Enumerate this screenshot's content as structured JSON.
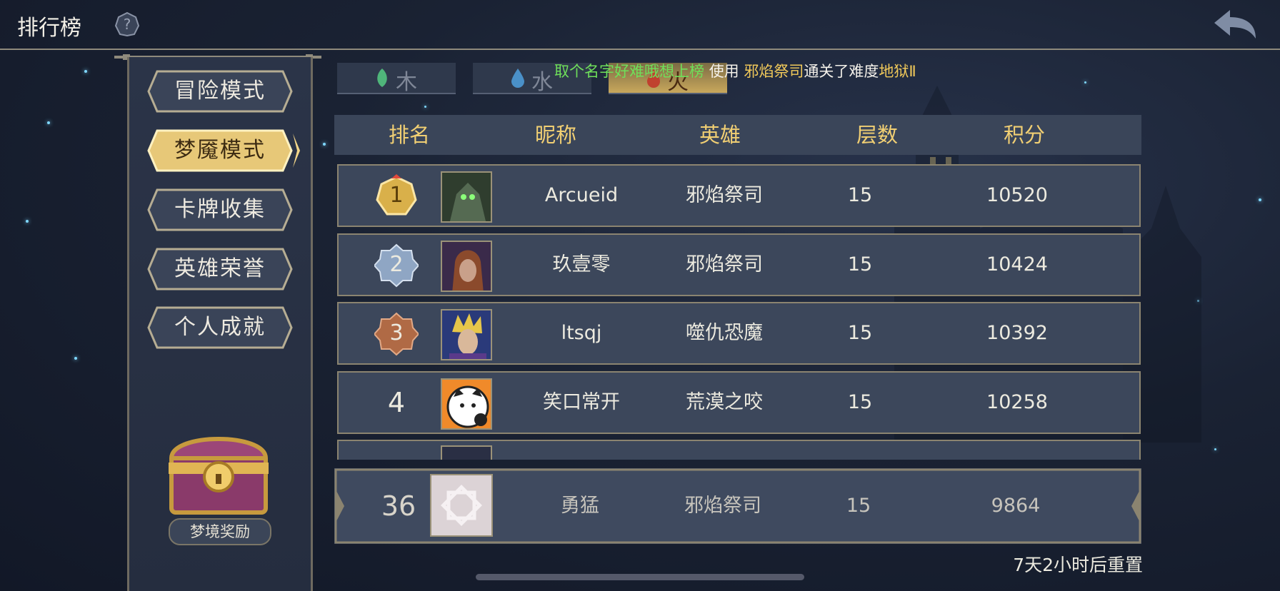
{
  "header": {
    "title": "排行榜",
    "help_icon": "question-icon",
    "back_icon": "back-arrow-icon"
  },
  "sidebar": {
    "items": [
      {
        "label": "冒险模式",
        "active": false
      },
      {
        "label": "梦魇模式",
        "active": true
      },
      {
        "label": "卡牌收集",
        "active": false
      },
      {
        "label": "英雄荣誉",
        "active": false
      },
      {
        "label": "个人成就",
        "active": false
      }
    ],
    "reward_label": "梦境奖励"
  },
  "tabs": [
    {
      "label": "木",
      "icon": "leaf-icon",
      "color": "#4fb57a"
    },
    {
      "label": "水",
      "icon": "water-drop-icon",
      "color": "#4a90c8"
    },
    {
      "label": "火",
      "icon": "fire-icon",
      "color": "#c0412f"
    }
  ],
  "banner": {
    "player": "取个名字好难哦想上榜",
    "use_text": "使用",
    "hero": "邪焰祭司",
    "cleared_text": "通关了难度",
    "difficulty": "地狱Ⅱ"
  },
  "table": {
    "columns": [
      "排名",
      "昵称",
      "英雄",
      "层数",
      "积分"
    ],
    "rows": [
      {
        "rank": "1",
        "name": "Arcueid",
        "hero": "邪焰祭司",
        "floors": "15",
        "score": "10520"
      },
      {
        "rank": "2",
        "name": "玖壹零",
        "hero": "邪焰祭司",
        "floors": "15",
        "score": "10424"
      },
      {
        "rank": "3",
        "name": "ltsqj",
        "hero": "噬仇恐魔",
        "floors": "15",
        "score": "10392"
      },
      {
        "rank": "4",
        "name": "笑口常开",
        "hero": "荒漠之咬",
        "floors": "15",
        "score": "10258"
      }
    ]
  },
  "my_rank": {
    "rank": "36",
    "name": "勇猛",
    "hero": "邪焰祭司",
    "floors": "15",
    "score": "9864"
  },
  "reset_text": "7天2小时后重置",
  "colors": {
    "gold": "#f1cf73",
    "rank1": "#d9b04a",
    "rank2": "#8fa6c4",
    "rank3": "#b06a45"
  }
}
